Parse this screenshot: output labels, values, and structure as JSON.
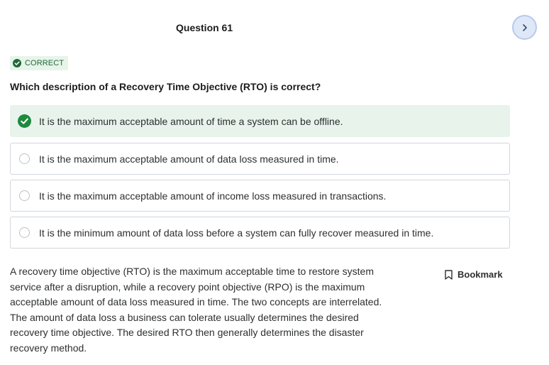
{
  "header": {
    "title": "Question 61"
  },
  "nav": {
    "next_icon": "chevron-right-icon"
  },
  "result": {
    "label": "CORRECT",
    "icon": "check-circle-icon",
    "color": "#1e6a38"
  },
  "question": {
    "text": "Which description of a Recovery Time Objective (RTO) is correct?"
  },
  "options": [
    {
      "text": "It is the maximum acceptable amount of time a system can be offline.",
      "correct": true,
      "selected": true
    },
    {
      "text": "It is the maximum acceptable amount of data loss measured in time.",
      "correct": false,
      "selected": false
    },
    {
      "text": "It is the maximum acceptable amount of income loss measured in transactions.",
      "correct": false,
      "selected": false
    },
    {
      "text": "It is the minimum amount of data loss before a system can fully recover measured in time.",
      "correct": false,
      "selected": false
    }
  ],
  "explanation": {
    "text": "A recovery time objective (RTO) is the maximum acceptable time to restore system service after a disruption, while a recovery point objective (RPO) is the maximum acceptable amount of data loss measured in time. The two concepts are interrelated. The amount of data loss a business can tolerate usually determines the desired recovery time objective. The desired RTO then generally determines the disaster recovery method."
  },
  "bookmark": {
    "label": "Bookmark",
    "icon": "bookmark-icon"
  },
  "colors": {
    "correct_bg": "#e8f3ec",
    "correct_check": "#1e8a3e",
    "nav_bg": "#dfe8f7"
  }
}
